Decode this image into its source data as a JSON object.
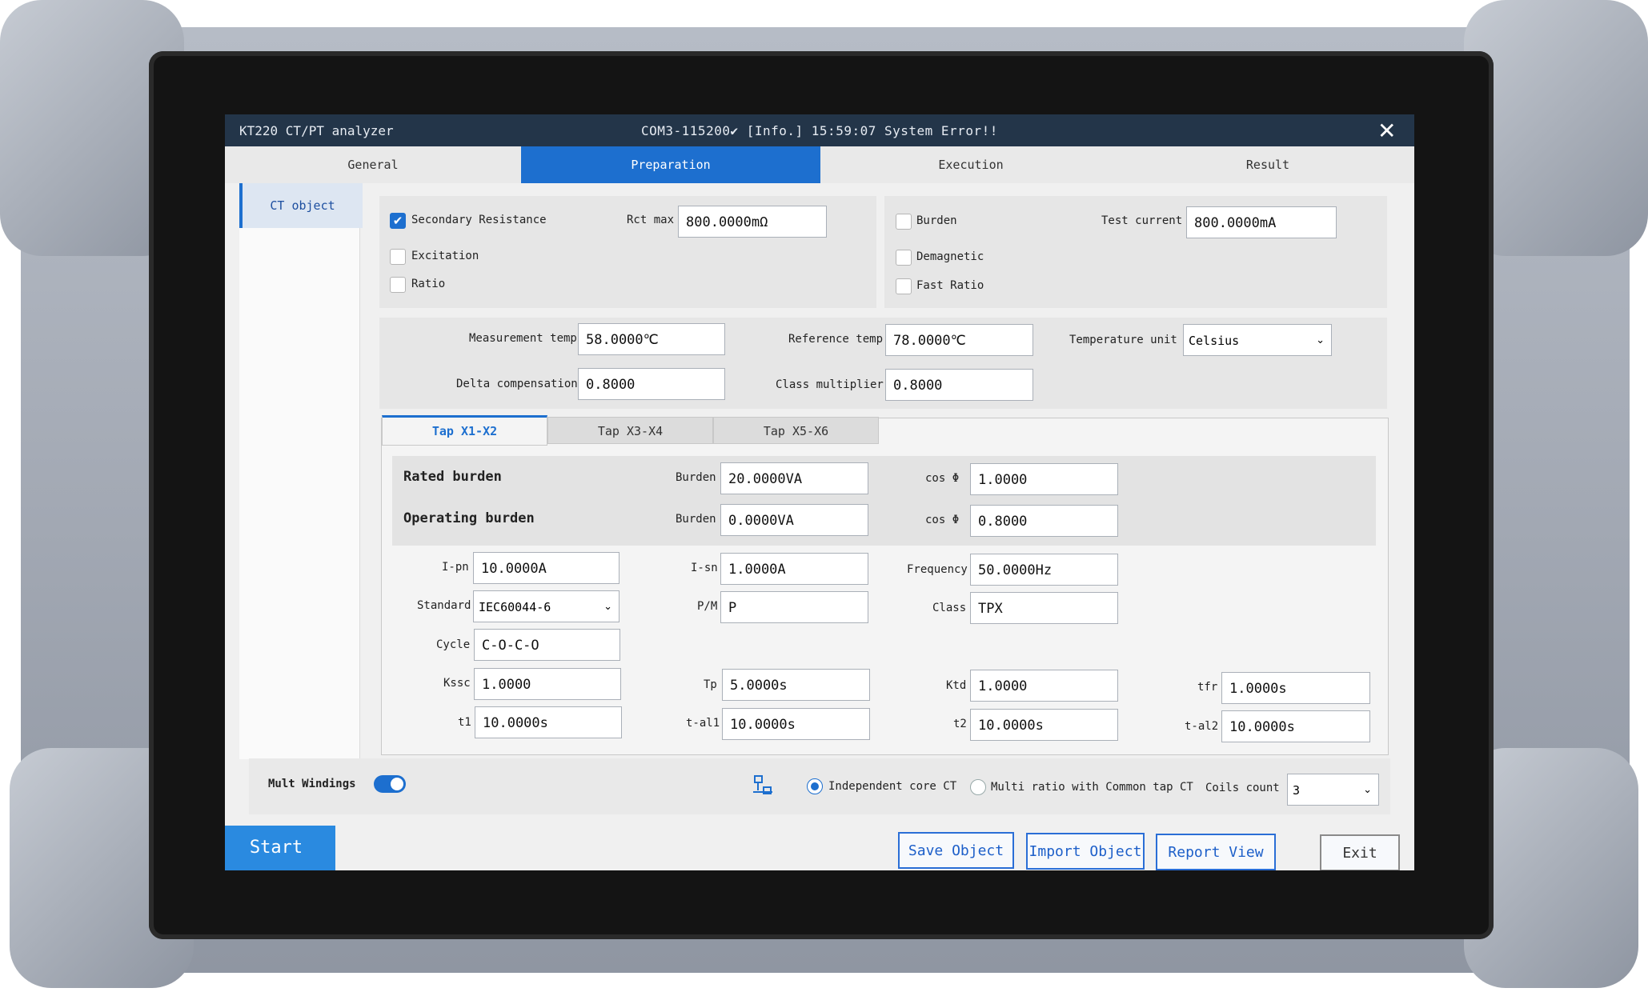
{
  "window": {
    "title": "KT220 CT/PT analyzer",
    "status": "COM3-115200✔  [Info.]  15:59:07 System Error!!",
    "close_glyph": "✕"
  },
  "tabs": [
    "General",
    "Preparation",
    "Execution",
    "Result"
  ],
  "sidebar": {
    "item": "CT object"
  },
  "tests": {
    "secondary_resistance": "Secondary Resistance",
    "rct_max_label": "Rct max",
    "rct_max_value": "800.0000mΩ",
    "excitation": "Excitation",
    "ratio": "Ratio",
    "burden": "Burden",
    "test_current_label": "Test current",
    "test_current_value": "800.0000mA",
    "demagnetic": "Demagnetic",
    "fast_ratio": "Fast Ratio",
    "checked": "✔"
  },
  "temps": {
    "measurement_temp_label": "Measurement temp",
    "measurement_temp_value": "58.0000℃",
    "reference_temp_label": "Reference temp",
    "reference_temp_value": "78.0000℃",
    "temperature_unit_label": "Temperature unit",
    "temperature_unit_value": "Celsius",
    "delta_comp_label": "Delta compensation",
    "delta_comp_value": "0.8000",
    "class_mult_label": "Class multiplier",
    "class_mult_value": "0.8000"
  },
  "subtabs": [
    "Tap X1-X2",
    "Tap X3-X4",
    "Tap X5-X6"
  ],
  "burden": {
    "rated_label": "Rated burden",
    "operating_label": "Operating burden",
    "burden_label": "Burden",
    "rated_burden": "20.0000VA",
    "operating_burden": "0.0000VA",
    "cos_label": "cos Φ",
    "rated_cos": "1.0000",
    "operating_cos": "0.8000"
  },
  "params": {
    "ipn_label": "I-pn",
    "ipn": "10.0000A",
    "isn_label": "I-sn",
    "isn": "1.0000A",
    "freq_label": "Frequency",
    "freq": "50.0000Hz",
    "standard_label": "Standard",
    "standard": "IEC60044-6",
    "pm_label": "P/M",
    "pm": "P",
    "class_label": "Class",
    "class": "TPX",
    "cycle_label": "Cycle",
    "cycle": "C-O-C-O",
    "kssc_label": "Kssc",
    "kssc": "1.0000",
    "tp_label": "Tp",
    "tp": "5.0000s",
    "ktd_label": "Ktd",
    "ktd": "1.0000",
    "tfr_label": "tfr",
    "tfr": "1.0000s",
    "t1_label": "t1",
    "t1": "10.0000s",
    "tal1_label": "t-al1",
    "tal1": "10.0000s",
    "t2_label": "t2",
    "t2": "10.0000s",
    "tal2_label": "t-al2",
    "tal2": "10.0000s"
  },
  "footer": {
    "mult_windings": "Mult Windings",
    "independent": "Independent core CT",
    "multi_ratio": "Multi ratio with Common tap CT",
    "coils_label": "Coils count",
    "coils_value": "3"
  },
  "buttons": {
    "start": "Start",
    "save": "Save Object",
    "import": "Import Object",
    "report": "Report View",
    "exit": "Exit"
  }
}
